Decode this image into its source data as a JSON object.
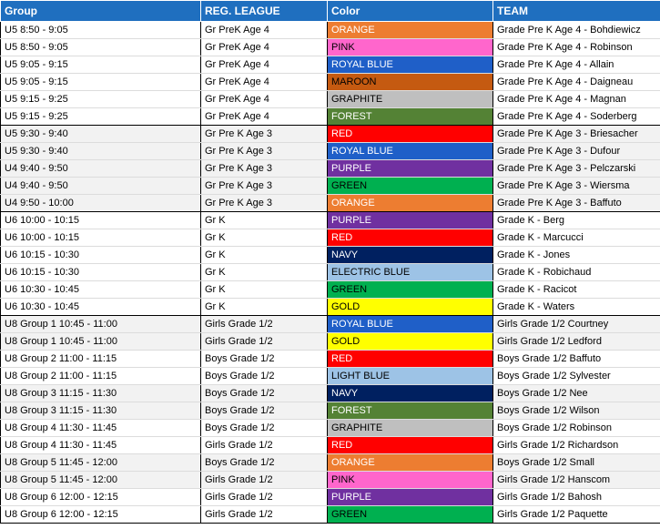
{
  "header": {
    "group": "Group",
    "league": "REG. LEAGUE",
    "color": "Color",
    "team": "TEAM"
  },
  "colors": {
    "header_bg": "#1f6fbf",
    "shade": "#f2f2f2"
  },
  "rows": [
    {
      "group": "U5 8:50 - 9:05",
      "league": "Gr PreK Age 4",
      "color": "ORANGE",
      "bg": "#ed7d31",
      "fg": "#ffffff",
      "team": "Grade Pre K Age 4 - Bohdiewicz",
      "shaded": false,
      "end": false
    },
    {
      "group": "U5 8:50 - 9:05",
      "league": "Gr PreK Age 4",
      "color": "PINK",
      "bg": "#ff66cc",
      "fg": "#000000",
      "team": "Grade Pre K Age 4 - Robinson",
      "shaded": false,
      "end": false
    },
    {
      "group": "U5 9:05 - 9:15",
      "league": "Gr PreK Age 4",
      "color": "ROYAL BLUE",
      "bg": "#1f5fc8",
      "fg": "#ffffff",
      "team": "Grade Pre K Age 4 - Allain",
      "shaded": false,
      "end": false
    },
    {
      "group": "U5 9:05 - 9:15",
      "league": "Gr PreK Age 4",
      "color": "MAROON",
      "bg": "#c55a11",
      "fg": "#000000",
      "team": "Grade Pre K Age 4 - Daigneau",
      "shaded": false,
      "end": false
    },
    {
      "group": "U5 9:15 - 9:25",
      "league": "Gr PreK Age 4",
      "color": "GRAPHITE",
      "bg": "#bfbfbf",
      "fg": "#000000",
      "team": "Grade Pre K Age 4 - Magnan",
      "shaded": false,
      "end": false
    },
    {
      "group": "U5 9:15 - 9:25",
      "league": "Gr PreK Age 4",
      "color": "FOREST",
      "bg": "#548235",
      "fg": "#ffffff",
      "team": "Grade Pre K Age 4 - Soderberg",
      "shaded": false,
      "end": true
    },
    {
      "group": "U5 9:30 - 9:40",
      "league": "Gr Pre K Age 3",
      "color": "RED",
      "bg": "#ff0000",
      "fg": "#ffffff",
      "team": "Grade Pre K Age 3 - Briesacher",
      "shaded": true,
      "end": false
    },
    {
      "group": "U5 9:30 - 9:40",
      "league": "Gr Pre K Age 3",
      "color": "ROYAL BLUE",
      "bg": "#1f5fc8",
      "fg": "#ffffff",
      "team": "Grade Pre K Age 3 - Dufour",
      "shaded": true,
      "end": false
    },
    {
      "group": "U4 9:40 - 9:50",
      "league": "Gr Pre K Age 3",
      "color": "PURPLE",
      "bg": "#7030a0",
      "fg": "#ffffff",
      "team": "Grade Pre K Age 3 - Pelczarski",
      "shaded": true,
      "end": false
    },
    {
      "group": "U4 9:40 - 9:50",
      "league": "Gr Pre K Age 3",
      "color": "GREEN",
      "bg": "#00b050",
      "fg": "#000000",
      "team": "Grade Pre K Age 3 - Wiersma",
      "shaded": true,
      "end": false
    },
    {
      "group": "U4 9:50 - 10:00",
      "league": "Gr Pre K Age 3",
      "color": "ORANGE",
      "bg": "#ed7d31",
      "fg": "#ffffff",
      "team": "Grade Pre K Age 3 - Baffuto",
      "shaded": true,
      "end": true
    },
    {
      "group": "U6 10:00 - 10:15",
      "league": "Gr K",
      "color": "PURPLE",
      "bg": "#7030a0",
      "fg": "#ffffff",
      "team": "Grade K - Berg",
      "shaded": false,
      "end": false
    },
    {
      "group": "U6 10:00 - 10:15",
      "league": "Gr K",
      "color": "RED",
      "bg": "#ff0000",
      "fg": "#ffffff",
      "team": "Grade K - Marcucci",
      "shaded": false,
      "end": false
    },
    {
      "group": "U6 10:15 - 10:30",
      "league": "Gr K",
      "color": "NAVY",
      "bg": "#002060",
      "fg": "#ffffff",
      "team": "Grade K - Jones",
      "shaded": false,
      "end": false
    },
    {
      "group": "U6 10:15 - 10:30",
      "league": "Gr K",
      "color": "ELECTRIC BLUE",
      "bg": "#9dc3e6",
      "fg": "#000000",
      "team": "Grade K - Robichaud",
      "shaded": false,
      "end": false
    },
    {
      "group": "U6 10:30 - 10:45",
      "league": "Gr K",
      "color": "GREEN",
      "bg": "#00b050",
      "fg": "#000000",
      "team": "Grade K - Racicot",
      "shaded": false,
      "end": false
    },
    {
      "group": "U6 10:30 - 10:45",
      "league": "Gr K",
      "color": "GOLD",
      "bg": "#ffff00",
      "fg": "#000000",
      "team": "Grade K - Waters",
      "shaded": false,
      "end": true
    },
    {
      "group": "U8 Group 1 10:45 - 11:00",
      "league": "Girls Grade 1/2",
      "color": "ROYAL BLUE",
      "bg": "#1f5fc8",
      "fg": "#ffffff",
      "team": "Girls Grade 1/2 Courtney",
      "shaded": true,
      "end": false
    },
    {
      "group": "U8 Group 1 10:45 - 11:00",
      "league": "Girls Grade 1/2",
      "color": "GOLD",
      "bg": "#ffff00",
      "fg": "#000000",
      "team": "Girls Grade 1/2 Ledford",
      "shaded": true,
      "end": false
    },
    {
      "group": "U8 Group 2 11:00 - 11:15",
      "league": "Boys Grade 1/2",
      "color": "RED",
      "bg": "#ff0000",
      "fg": "#ffffff",
      "team": "Boys Grade 1/2 Baffuto",
      "shaded": false,
      "end": false
    },
    {
      "group": "U8 Group 2 11:00 - 11:15",
      "league": "Boys Grade 1/2",
      "color": "LIGHT BLUE",
      "bg": "#9dc3e6",
      "fg": "#000000",
      "team": "Boys Grade 1/2 Sylvester",
      "shaded": false,
      "end": false
    },
    {
      "group": "U8 Group 3 11:15 - 11:30",
      "league": "Boys Grade 1/2",
      "color": "NAVY",
      "bg": "#002060",
      "fg": "#ffffff",
      "team": "Boys Grade 1/2 Nee",
      "shaded": true,
      "end": false
    },
    {
      "group": "U8 Group 3 11:15 - 11:30",
      "league": "Boys Grade 1/2",
      "color": "FOREST",
      "bg": "#548235",
      "fg": "#ffffff",
      "team": "Boys Grade 1/2 Wilson",
      "shaded": true,
      "end": false
    },
    {
      "group": "U8 Group 4 11:30 - 11:45",
      "league": "Boys Grade 1/2",
      "color": "GRAPHITE",
      "bg": "#bfbfbf",
      "fg": "#000000",
      "team": "Boys Grade 1/2 Robinson",
      "shaded": false,
      "end": false
    },
    {
      "group": "U8 Group 4 11:30 - 11:45",
      "league": "Girls Grade 1/2",
      "color": "RED",
      "bg": "#ff0000",
      "fg": "#ffffff",
      "team": "Girls Grade 1/2 Richardson",
      "shaded": false,
      "end": false
    },
    {
      "group": "U8 Group 5 11:45 - 12:00",
      "league": "Boys Grade 1/2",
      "color": "ORANGE",
      "bg": "#ed7d31",
      "fg": "#ffffff",
      "team": "Boys Grade 1/2 Small",
      "shaded": true,
      "end": false
    },
    {
      "group": "U8 Group 5 11:45 - 12:00",
      "league": "Girls Grade 1/2",
      "color": "PINK",
      "bg": "#ff66cc",
      "fg": "#000000",
      "team": "Girls Grade 1/2 Hanscom",
      "shaded": true,
      "end": false
    },
    {
      "group": "U8 Group 6 12:00 - 12:15",
      "league": "Girls Grade 1/2",
      "color": "PURPLE",
      "bg": "#7030a0",
      "fg": "#ffffff",
      "team": "Girls Grade 1/2 Bahosh",
      "shaded": false,
      "end": false
    },
    {
      "group": "U8 Group 6 12:00 - 12:15",
      "league": "Girls Grade 1/2",
      "color": "GREEN",
      "bg": "#00b050",
      "fg": "#000000",
      "team": "Girls Grade 1/2 Paquette",
      "shaded": false,
      "end": true
    }
  ]
}
